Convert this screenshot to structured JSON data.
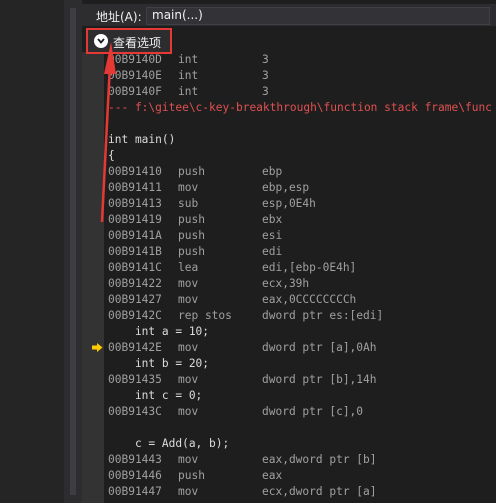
{
  "address_bar": {
    "label": "地址(A):",
    "value": "main(...)"
  },
  "view_options": {
    "label": "查看选项",
    "icon": "chevron-down-icon"
  },
  "colors": {
    "background": "#1e1e1e",
    "annotation_red": "#e53935",
    "comment_red": "#e05050",
    "instruction_pointer": "#ffcc00"
  },
  "lines": [
    {
      "type": "asm",
      "addr": "00B9140D",
      "op": "int",
      "args": "3"
    },
    {
      "type": "asm",
      "addr": "00B9140E",
      "op": "int",
      "args": "3"
    },
    {
      "type": "asm",
      "addr": "00B9140F",
      "op": "int",
      "args": "3"
    },
    {
      "type": "comment",
      "text": "--- f:\\gitee\\c-key-breakthrough\\function stack frame\\func"
    },
    {
      "type": "blank",
      "text": ""
    },
    {
      "type": "source",
      "text": "int main()"
    },
    {
      "type": "source",
      "text": "{"
    },
    {
      "type": "asm",
      "addr": "00B91410",
      "op": "push",
      "args": "ebp"
    },
    {
      "type": "asm",
      "addr": "00B91411",
      "op": "mov",
      "args": "ebp,esp"
    },
    {
      "type": "asm",
      "addr": "00B91413",
      "op": "sub",
      "args": "esp,0E4h"
    },
    {
      "type": "asm",
      "addr": "00B91419",
      "op": "push",
      "args": "ebx"
    },
    {
      "type": "asm",
      "addr": "00B9141A",
      "op": "push",
      "args": "esi"
    },
    {
      "type": "asm",
      "addr": "00B9141B",
      "op": "push",
      "args": "edi"
    },
    {
      "type": "asm",
      "addr": "00B9141C",
      "op": "lea",
      "args": "edi,[ebp-0E4h]"
    },
    {
      "type": "asm",
      "addr": "00B91422",
      "op": "mov",
      "args": "ecx,39h"
    },
    {
      "type": "asm",
      "addr": "00B91427",
      "op": "mov",
      "args": "eax,0CCCCCCCCh"
    },
    {
      "type": "asm",
      "addr": "00B9142C",
      "op": "rep stos",
      "args": "dword ptr es:[edi]"
    },
    {
      "type": "source",
      "text": "    int a = 10;"
    },
    {
      "type": "asm",
      "addr": "00B9142E",
      "op": "mov",
      "args": "dword ptr [a],0Ah",
      "current": true
    },
    {
      "type": "source",
      "text": "    int b = 20;"
    },
    {
      "type": "asm",
      "addr": "00B91435",
      "op": "mov",
      "args": "dword ptr [b],14h"
    },
    {
      "type": "source",
      "text": "    int c = 0;"
    },
    {
      "type": "asm",
      "addr": "00B9143C",
      "op": "mov",
      "args": "dword ptr [c],0"
    },
    {
      "type": "blank",
      "text": ""
    },
    {
      "type": "source",
      "text": "    c = Add(a, b);"
    },
    {
      "type": "asm",
      "addr": "00B91443",
      "op": "mov",
      "args": "eax,dword ptr [b]"
    },
    {
      "type": "asm",
      "addr": "00B91446",
      "op": "push",
      "args": "eax"
    },
    {
      "type": "asm",
      "addr": "00B91447",
      "op": "mov",
      "args": "ecx,dword ptr [a]"
    }
  ]
}
